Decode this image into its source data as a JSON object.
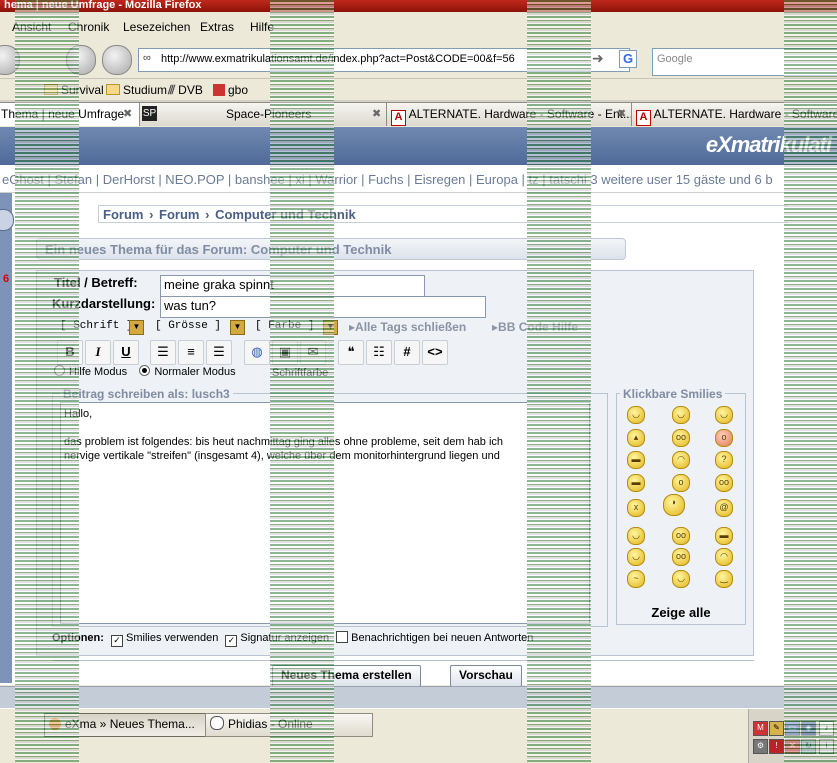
{
  "window": {
    "title": "hema | neue Umfrage - Mozilla Firefox"
  },
  "menu": [
    "Ansicht",
    "Chronik",
    "Lesezeichen",
    "Extras",
    "Hilfe"
  ],
  "navigation": {
    "url": "http://www.exmatrikulationsamt.de/index.php?act=Post&CODE=00&f=56",
    "search_engine": "G",
    "search_placeholder": "Google"
  },
  "bookmarks": [
    "Survival",
    "Studium",
    "DVB",
    "gbo"
  ],
  "tabs": [
    {
      "label": "Thema | neue Umfrage",
      "active": true
    },
    {
      "label": "Space-Pioneers",
      "active": false
    },
    {
      "label": "ALTERNATE. Hardware - Software - Ent...",
      "active": false
    },
    {
      "label": "ALTERNATE. Hardware - Software",
      "active": false
    }
  ],
  "site": {
    "logo": "eXmatrikulati",
    "online_users": "eGhost | Stefan | DerHorst | NEO.POP | banshee | xi | Warrior | Fuchs | Eisregen | Europa | tz | tatschi 3 weitere user 15 gäste und 6 b"
  },
  "breadcrumb": [
    "Forum",
    "Forum",
    "Computer und Technik"
  ],
  "form": {
    "heading": "Ein neues Thema für das Forum: Computer und Technik",
    "title_label": "Titel / Betreff:",
    "title_value": "meine graka spinnt",
    "desc_label": "Kurzdarstellung:",
    "desc_value": "was tun?",
    "font_select": "[ Schrift ]",
    "size_select": "[ Grösse ]",
    "color_select": "[ Farbe ]",
    "close_tags": "Alle Tags schließen",
    "bb_code": "BB Code Hilfe",
    "mode_help": "Hilfe Modus",
    "mode_normal": "Normaler Modus",
    "font_color_label": "Schriftfarbe",
    "post_legend": "Beitrag schreiben als: lusch3",
    "post_text": "Hallo,\n\ndas problem ist folgendes: bis heut nachmittag ging alles ohne probleme, seit dem hab ich\nnervige vertikale \"streifen\" (insgesamt 4), welche über dem monitorhintergrund liegen und",
    "smilies_legend": "Klickbare Smilies",
    "show_all": "Zeige alle",
    "options_label": "Optionen:",
    "opt_smilies": "Smilies verwenden",
    "opt_signature": "Signatur anzeigen",
    "opt_notify": "Benachrichtigen bei neuen Antworten",
    "submit": "Neues Thema erstellen",
    "preview": "Vorschau"
  },
  "toolbar_icons": [
    "bold-icon",
    "italic-icon",
    "underline-icon",
    "align-left-icon",
    "align-center-icon",
    "align-right-icon",
    "globe-link-icon",
    "image-icon",
    "email-icon",
    "quote-icon",
    "list-icon",
    "hash-icon",
    "code-icon"
  ],
  "taskbar": [
    {
      "label": "eXma » Neues Thema...",
      "active": true
    },
    {
      "label": "Phidias - Online",
      "active": false
    }
  ],
  "colors": {
    "titlebar": "#c0281c",
    "header": "#5a74a2",
    "accent_text": "#4b5f82"
  }
}
